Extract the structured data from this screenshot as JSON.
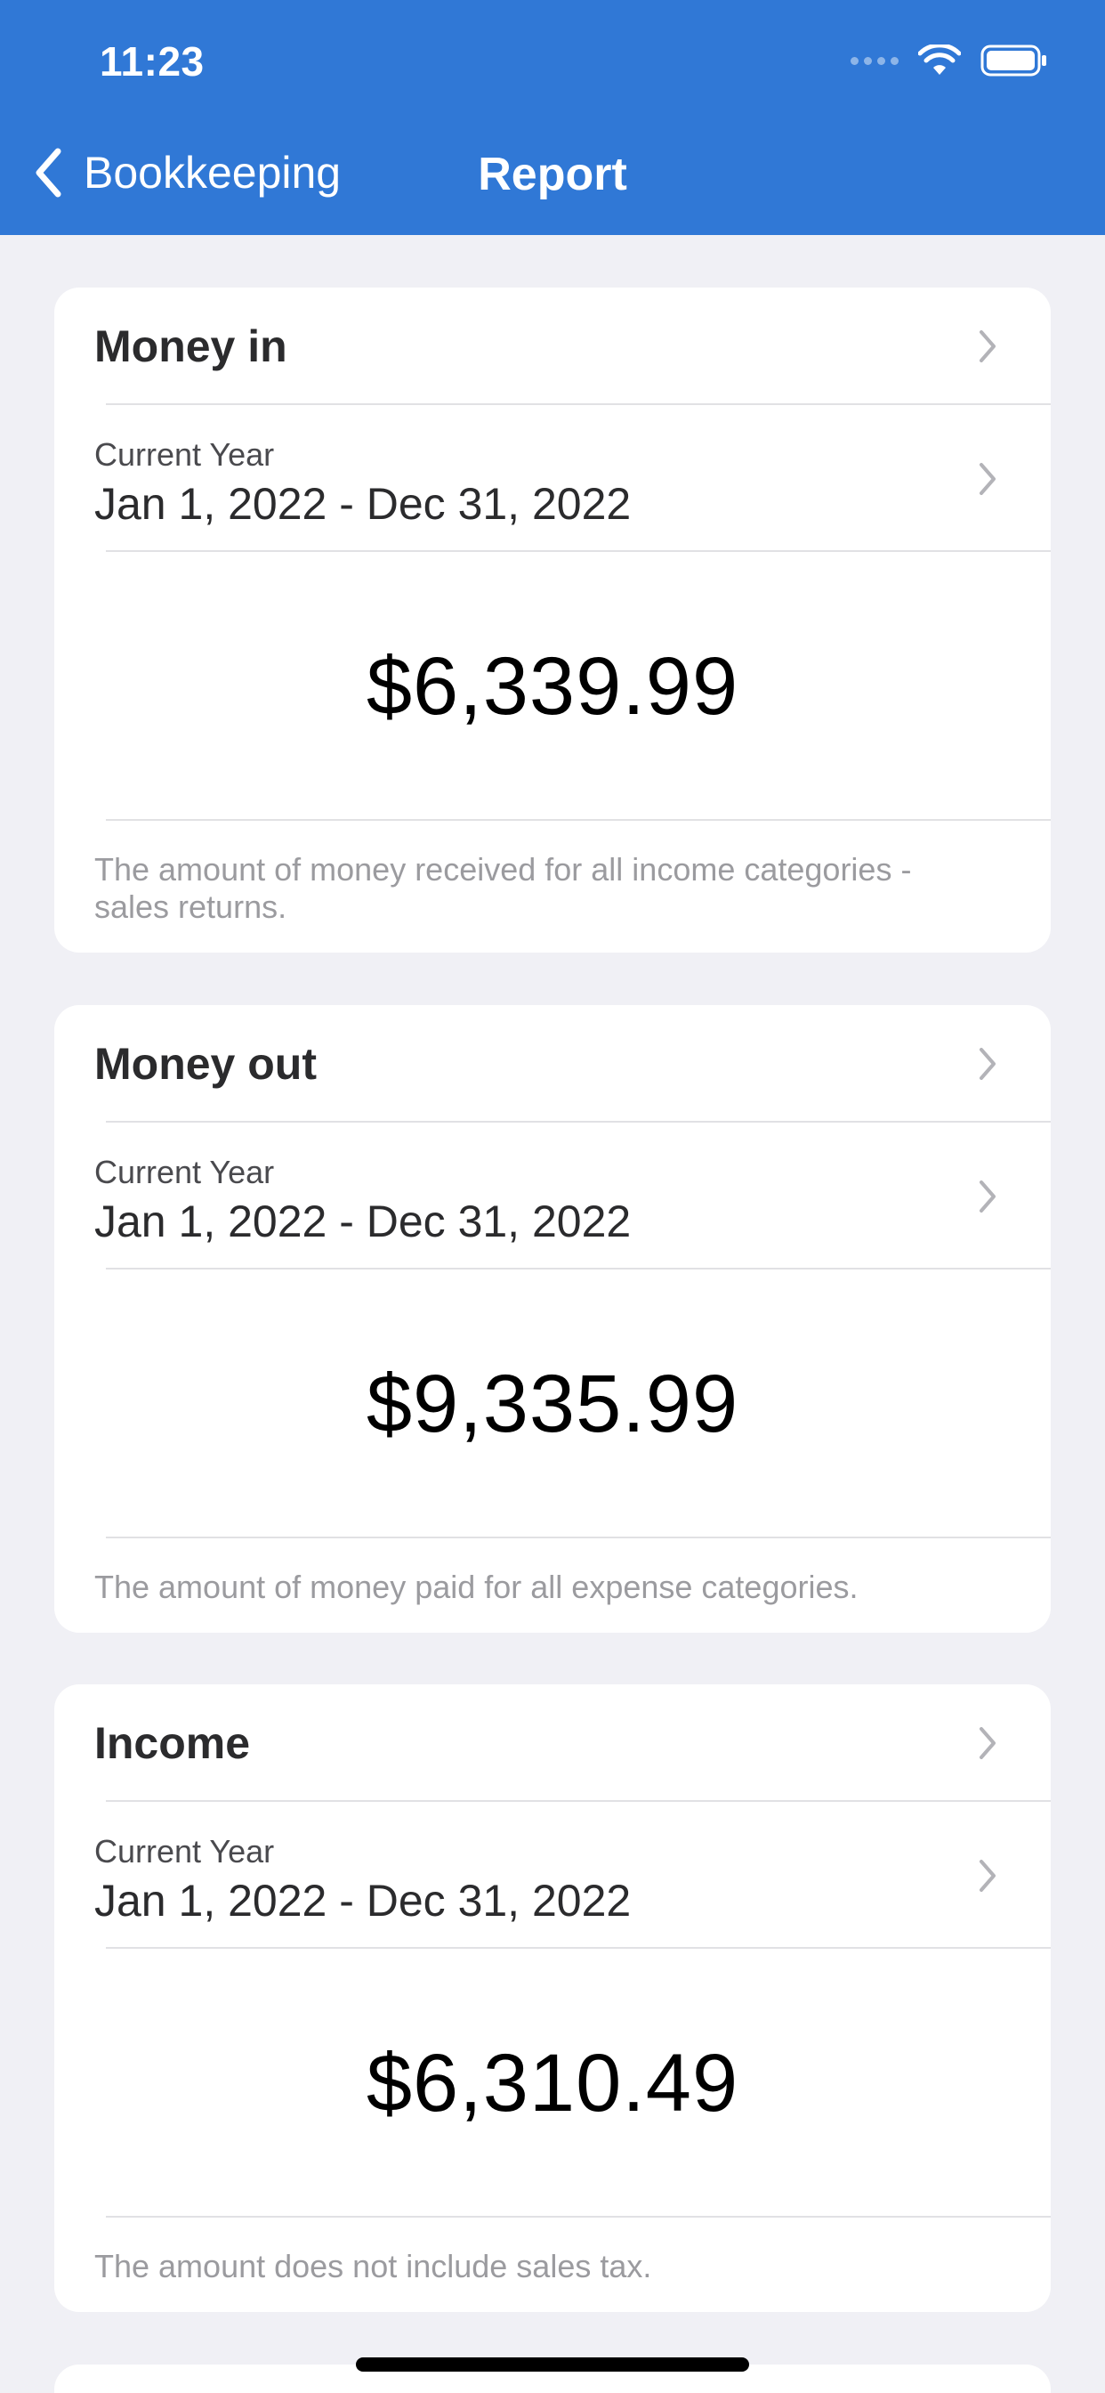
{
  "status_bar": {
    "time": "11:23"
  },
  "nav": {
    "back_label": "Bookkeeping",
    "title": "Report"
  },
  "cards": [
    {
      "title": "Money in",
      "period_label": "Current Year",
      "period_range": "Jan 1, 2022 - Dec 31, 2022",
      "amount": "$6,339.99",
      "note": "The amount of money received for all income categories - sales returns."
    },
    {
      "title": "Money out",
      "period_label": "Current Year",
      "period_range": "Jan 1, 2022 - Dec 31, 2022",
      "amount": "$9,335.99",
      "note": "The amount of money paid for all expense categories."
    },
    {
      "title": "Income",
      "period_label": "Current Year",
      "period_range": "Jan 1, 2022 - Dec 31, 2022",
      "amount": "$6,310.49",
      "note": "The amount does not include sales tax."
    }
  ],
  "colors": {
    "header": "#3078d6",
    "background": "#f0f0f5",
    "note_text": "#9b9b9f"
  },
  "icons": [
    "chevron-left-icon",
    "chevron-right-icon",
    "wifi-icon",
    "battery-icon",
    "signal-icon"
  ]
}
